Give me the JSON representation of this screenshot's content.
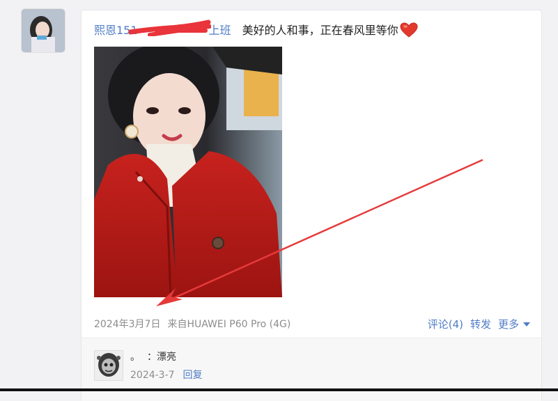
{
  "post": {
    "author_visible": "熙恩151",
    "author_suffix": "上班",
    "status_text": "美好的人和事，正在春风里等你",
    "heart_icon": "heart-icon",
    "date": "2024年3月7日",
    "source": "来自HUAWEI P60 Pro (4G)"
  },
  "actions": {
    "comments_label": "评论(4)",
    "repost_label": "转发",
    "more_label": "更多"
  },
  "comment": {
    "bullet": "。",
    "text": "：漂亮",
    "date": "2024-3-7",
    "reply_label": "回复"
  },
  "colors": {
    "link": "#4f7cc6",
    "annotation_arrow": "#e63a3a",
    "redaction": "#e8343a"
  }
}
